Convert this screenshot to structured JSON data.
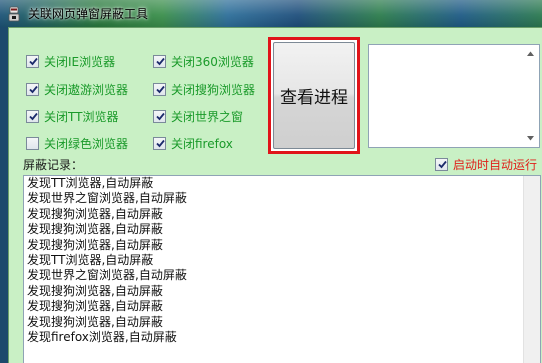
{
  "window": {
    "title": "关联网页弹窗屏蔽工具"
  },
  "checkboxes": [
    {
      "label": "关闭IE浏览器",
      "checked": true
    },
    {
      "label": "关闭360浏览器",
      "checked": true
    },
    {
      "label": "关闭遨游浏览器",
      "checked": true
    },
    {
      "label": "关闭搜狗浏览器",
      "checked": true
    },
    {
      "label": "关闭TT浏览器",
      "checked": true
    },
    {
      "label": "关闭世界之窗",
      "checked": true
    },
    {
      "label": "关闭绿色浏览器",
      "checked": false
    },
    {
      "label": "关闭firefox",
      "checked": true
    }
  ],
  "process_button": {
    "label": "查看进程"
  },
  "log": {
    "label": "屏蔽记录：",
    "autostart_label": "启动时自动运行",
    "autostart_checked": true,
    "lines": [
      "发现TT浏览器,自动屏蔽",
      "发现世界之窗浏览器,自动屏蔽",
      "发现搜狗浏览器,自动屏蔽",
      "发现搜狗浏览器,自动屏蔽",
      "发现搜狗浏览器,自动屏蔽",
      "发现TT浏览器,自动屏蔽",
      "发现世界之窗浏览器,自动屏蔽",
      "发现搜狗浏览器,自动屏蔽",
      "发现搜狗浏览器,自动屏蔽",
      "发现搜狗浏览器,自动屏蔽",
      "发现firefox浏览器,自动屏蔽"
    ]
  },
  "colors": {
    "client_bg": "#c9f0c5",
    "checkbox_label": "#1a9a2a",
    "autostart_label": "#e0201a",
    "highlight_border": "#e0141a"
  }
}
